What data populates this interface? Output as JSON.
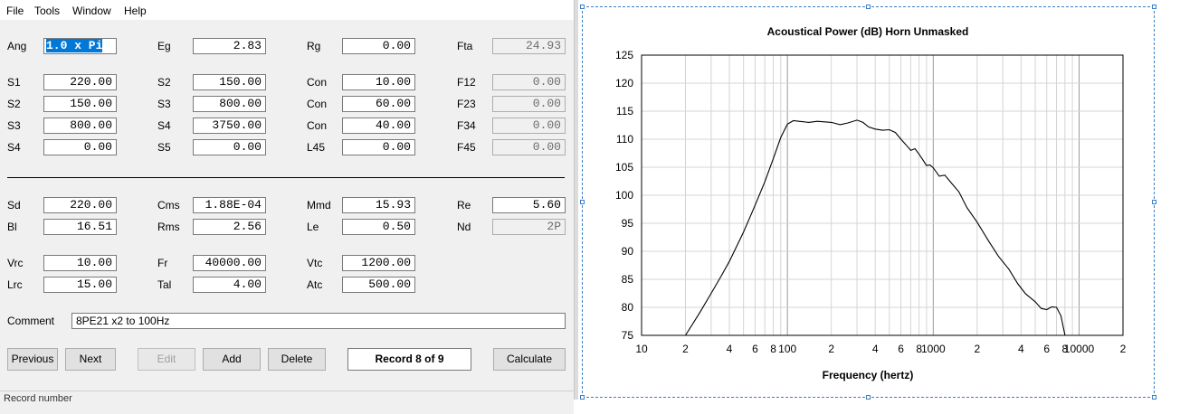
{
  "menu": [
    "File",
    "Tools",
    "Window",
    "Help"
  ],
  "form": {
    "row1": [
      {
        "label": "Ang",
        "value": "1.0 x Pi"
      },
      {
        "label": "Eg",
        "value": "2.83"
      },
      {
        "label": "Rg",
        "value": "0.00"
      },
      {
        "label": "Fta",
        "value": "24.93"
      }
    ],
    "rows": [
      [
        {
          "label": "S1",
          "value": "220.00"
        },
        {
          "label": "S2",
          "value": "150.00"
        },
        {
          "label": "Con",
          "value": "10.00"
        },
        {
          "label": "F12",
          "value": "0.00"
        }
      ],
      [
        {
          "label": "S2",
          "value": "150.00"
        },
        {
          "label": "S3",
          "value": "800.00"
        },
        {
          "label": "Con",
          "value": "60.00"
        },
        {
          "label": "F23",
          "value": "0.00"
        }
      ],
      [
        {
          "label": "S3",
          "value": "800.00"
        },
        {
          "label": "S4",
          "value": "3750.00"
        },
        {
          "label": "Con",
          "value": "40.00"
        },
        {
          "label": "F34",
          "value": "0.00"
        }
      ],
      [
        {
          "label": "S4",
          "value": "0.00"
        },
        {
          "label": "S5",
          "value": "0.00"
        },
        {
          "label": "L45",
          "value": "0.00"
        },
        {
          "label": "F45",
          "value": "0.00"
        }
      ]
    ],
    "driver": [
      [
        {
          "label": "Sd",
          "value": "220.00"
        },
        {
          "label": "Cms",
          "value": "1.88E-04"
        },
        {
          "label": "Mmd",
          "value": "15.93"
        },
        {
          "label": "Re",
          "value": "5.60"
        }
      ],
      [
        {
          "label": "Bl",
          "value": "16.51"
        },
        {
          "label": "Rms",
          "value": "2.56"
        },
        {
          "label": "Le",
          "value": "0.50"
        },
        {
          "label": "Nd",
          "value": "2P"
        }
      ]
    ],
    "chamber": [
      [
        {
          "label": "Vrc",
          "value": "10.00"
        },
        {
          "label": "Fr",
          "value": "40000.00"
        },
        {
          "label": "Vtc",
          "value": "1200.00"
        }
      ],
      [
        {
          "label": "Lrc",
          "value": "15.00"
        },
        {
          "label": "Tal",
          "value": "4.00"
        },
        {
          "label": "Atc",
          "value": "500.00"
        }
      ]
    ],
    "comment_label": "Comment",
    "comment_value": "8PE21 x2 to 100Hz"
  },
  "buttons": {
    "previous": "Previous",
    "next": "Next",
    "edit": "Edit",
    "add": "Add",
    "delete": "Delete",
    "record": "Record 8 of 9",
    "calculate": "Calculate"
  },
  "status": {
    "text": "Record number"
  },
  "chart_data": {
    "type": "line",
    "title": "Acoustical Power (dB)   Horn   Unmasked",
    "xlabel": "Frequency (hertz)",
    "ylabel": "",
    "x_scale": "log",
    "xlim": [
      10,
      20000
    ],
    "ylim": [
      75,
      125
    ],
    "yticks": [
      75,
      80,
      85,
      90,
      95,
      100,
      105,
      110,
      115,
      120,
      125
    ],
    "xtick_labels": [
      {
        "x": 10,
        "label": "10"
      },
      {
        "x": 20,
        "label": "2"
      },
      {
        "x": 40,
        "label": "4"
      },
      {
        "x": 60,
        "label": "6"
      },
      {
        "x": 80,
        "label": "8"
      },
      {
        "x": 100,
        "label": "100"
      },
      {
        "x": 200,
        "label": "2"
      },
      {
        "x": 400,
        "label": "4"
      },
      {
        "x": 600,
        "label": "6"
      },
      {
        "x": 800,
        "label": "8"
      },
      {
        "x": 1000,
        "label": "1000"
      },
      {
        "x": 2000,
        "label": "2"
      },
      {
        "x": 4000,
        "label": "4"
      },
      {
        "x": 6000,
        "label": "6"
      },
      {
        "x": 8000,
        "label": "8"
      },
      {
        "x": 10000,
        "label": "10000"
      },
      {
        "x": 20000,
        "label": "2"
      }
    ],
    "grid": true,
    "series": [
      {
        "x": [
          20,
          25,
          30,
          35,
          40,
          50,
          60,
          70,
          80,
          90,
          100,
          110,
          120,
          140,
          160,
          180,
          200,
          230,
          260,
          300,
          330,
          360,
          400,
          450,
          500,
          550,
          600,
          650,
          700,
          750,
          800,
          850,
          900,
          950,
          1000,
          1100,
          1200,
          1300,
          1500,
          1700,
          2000,
          2400,
          2800,
          3300,
          3800,
          4300,
          5000,
          5500,
          6000,
          6500,
          7000,
          7500,
          8000
        ],
        "y": [
          75,
          79,
          82.5,
          85.5,
          88.2,
          93.4,
          98.2,
          102.4,
          106.5,
          110.3,
          112.7,
          113.3,
          113.2,
          113.0,
          113.2,
          113.1,
          113.0,
          112.6,
          112.9,
          113.4,
          113.0,
          112.2,
          111.8,
          111.6,
          111.7,
          111.2,
          110.0,
          109.0,
          108.0,
          108.3,
          107.3,
          106.3,
          105.3,
          105.4,
          104.9,
          103.4,
          103.6,
          102.5,
          100.6,
          97.8,
          95.2,
          91.8,
          89.1,
          86.8,
          84.2,
          82.4,
          81.0,
          79.8,
          79.6,
          80.1,
          80.0,
          78.5,
          75.0
        ]
      }
    ]
  }
}
